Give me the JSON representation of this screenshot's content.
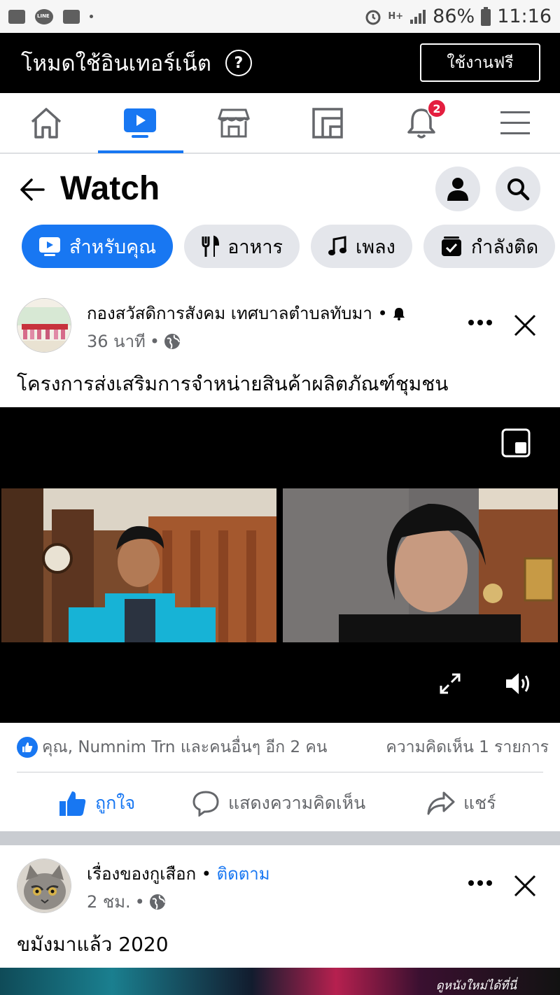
{
  "status_bar": {
    "network": "H+",
    "battery": "86%",
    "time": "11:16",
    "line_badge": "LINE"
  },
  "banner": {
    "title": "โหมดใช้อินเทอร์เน็ต",
    "help": "?",
    "free_button": "ใช้งานฟรี"
  },
  "nav": {
    "notification_count": "2"
  },
  "watch": {
    "title": "Watch"
  },
  "chips": [
    {
      "label": "สำหรับคุณ",
      "icon": "play-icon",
      "active": true
    },
    {
      "label": "อาหาร",
      "icon": "utensils-icon",
      "active": false
    },
    {
      "label": "เพลง",
      "icon": "music-note-icon",
      "active": false
    },
    {
      "label": "กำลังติด",
      "icon": "following-icon",
      "active": false
    }
  ],
  "post1": {
    "page_name": "กองสวัสดิการสังคม เทศบาลตำบลทับมา",
    "time": "36 นาที",
    "text": "โครงการส่งเสริมการจำหน่ายสินค้าผลิตภัณฑ์ชุมชน",
    "reactions_text": "คุณ, Numnim Trn และคนอื่นๆ อีก 2 คน",
    "comments_text": "ความคิดเห็น 1 รายการ",
    "actions": {
      "like": "ถูกใจ",
      "comment": "แสดงความคิดเห็น",
      "share": "แชร์"
    }
  },
  "post2": {
    "page_name": "เรื่องของกูเสือก",
    "follow": "ติดตาม",
    "time": "2 ชม.",
    "text": "ขมังมาแล้ว 2020",
    "video_tag": "ดูหนังใหม่ได้ที่นี่"
  },
  "colors": {
    "accent": "#1877f2",
    "badge": "#e41e3f",
    "chip_bg": "#e4e6eb",
    "muted": "#65676b"
  }
}
